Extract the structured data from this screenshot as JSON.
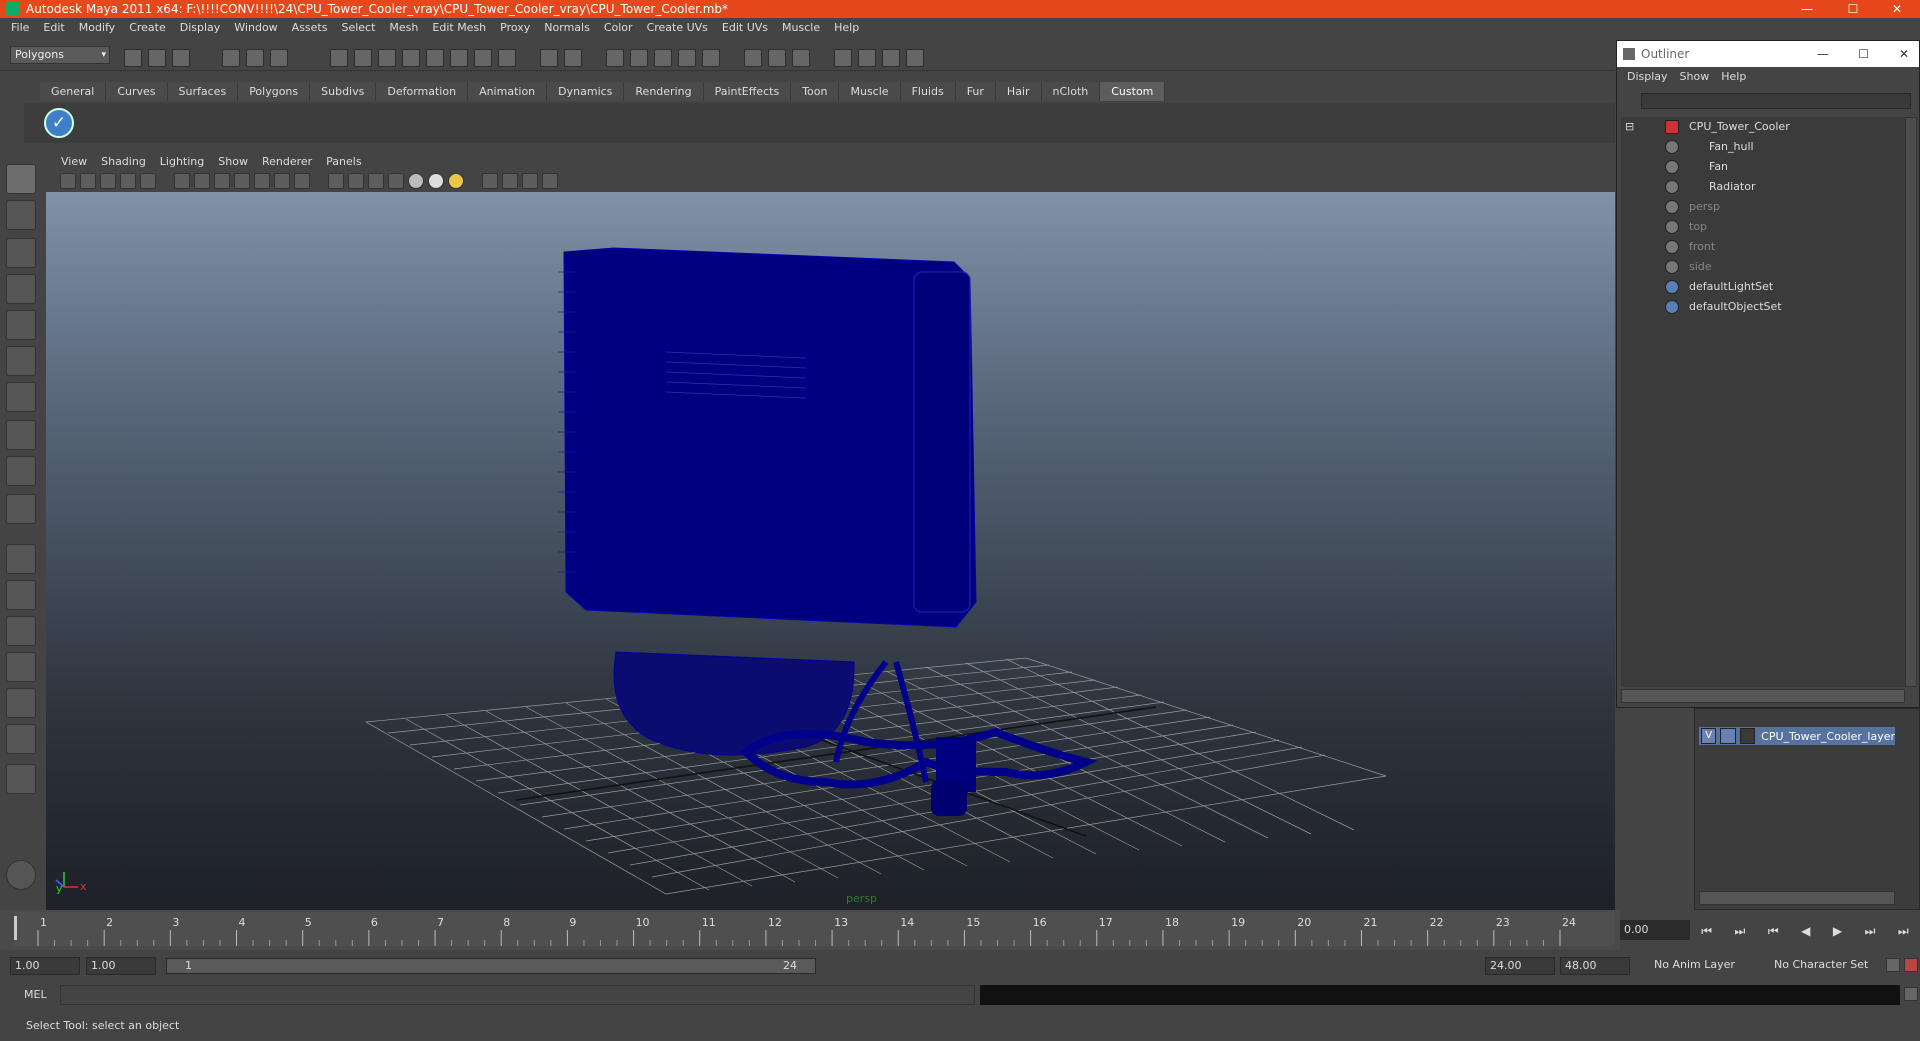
{
  "window": {
    "title": "Autodesk Maya 2011 x64: F:\\!!!!CONV!!!!\\24\\CPU_Tower_Cooler_vray\\CPU_Tower_Cooler_vray\\CPU_Tower_Cooler.mb*",
    "minimize": "—",
    "maximize": "☐",
    "close": "✕"
  },
  "menubar": [
    "File",
    "Edit",
    "Modify",
    "Create",
    "Display",
    "Window",
    "Assets",
    "Select",
    "Mesh",
    "Edit Mesh",
    "Proxy",
    "Normals",
    "Color",
    "Create UVs",
    "Edit UVs",
    "Muscle",
    "Help"
  ],
  "statusline": {
    "mode": "Polygons",
    "mode_arrow": "▾"
  },
  "shelf_tabs": [
    "General",
    "Curves",
    "Surfaces",
    "Polygons",
    "Subdivs",
    "Deformation",
    "Animation",
    "Dynamics",
    "Rendering",
    "PaintEffects",
    "Toon",
    "Muscle",
    "Fluids",
    "Fur",
    "Hair",
    "nCloth",
    "Custom"
  ],
  "shelf_icon": "✓",
  "viewport": {
    "menus": [
      "View",
      "Shading",
      "Lighting",
      "Show",
      "Renderer",
      "Panels"
    ],
    "camera_label": "persp",
    "axis_y": "y",
    "axis_x": "x"
  },
  "outliner": {
    "title": "Outliner",
    "menus": [
      "Display",
      "Show",
      "Help"
    ],
    "items": [
      {
        "label": "CPU_Tower_Cooler",
        "dim": false
      },
      {
        "label": "Fan_hull",
        "dim": false
      },
      {
        "label": "Fan",
        "dim": false
      },
      {
        "label": "Radiator",
        "dim": false
      },
      {
        "label": "persp",
        "dim": true
      },
      {
        "label": "top",
        "dim": true
      },
      {
        "label": "front",
        "dim": true
      },
      {
        "label": "side",
        "dim": true
      },
      {
        "label": "defaultLightSet",
        "dim": false
      },
      {
        "label": "defaultObjectSet",
        "dim": false
      }
    ],
    "collapse_toggle": "⊟"
  },
  "layers": {
    "visible_flag": "V",
    "layer_name": "CPU_Tower_Cooler_layer"
  },
  "timeline": {
    "ticks": [
      "1",
      "2",
      "3",
      "4",
      "5",
      "6",
      "7",
      "8",
      "9",
      "10",
      "11",
      "12",
      "13",
      "14",
      "15",
      "16",
      "17",
      "18",
      "19",
      "20",
      "21",
      "22",
      "23",
      "24"
    ],
    "current_time": "0.00",
    "playback_buttons": [
      "⏮",
      "⏭",
      "⏮",
      "◀",
      "▶",
      "⏭",
      "⏭"
    ]
  },
  "range": {
    "start_time": "1.00",
    "playback_start": "1.00",
    "slider_start": "1",
    "slider_end": "24",
    "playback_end": "24.00",
    "end_time": "48.00",
    "anim_layer": "No Anim Layer",
    "character_set": "No Character Set"
  },
  "command_line": {
    "label": "MEL"
  },
  "help_line": "Select Tool: select an object",
  "colors": {
    "title_bar": "#e7481b",
    "wireframe": "#000080",
    "grid": "#9a9a9a"
  }
}
